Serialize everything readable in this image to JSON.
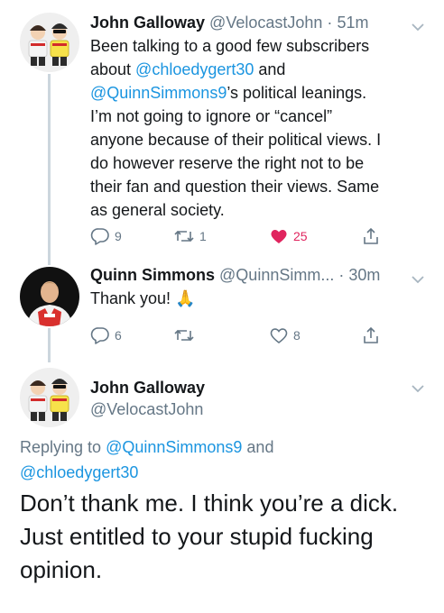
{
  "tweets": [
    {
      "name": "John Galloway",
      "handle": "@VelocastJohn",
      "separator": "·",
      "time": "51m",
      "text_lines": [
        [
          {
            "t": "Been talking to a good few subscribers"
          }
        ],
        [
          {
            "t": "about "
          },
          {
            "t": "@chloedygert30",
            "mention": true
          },
          {
            "t": " and"
          }
        ],
        [
          {
            "t": "@QuinnSimmons9",
            "mention": true
          },
          {
            "t": "’s political leanings."
          }
        ],
        [
          {
            "t": "I’m not going to ignore or “cancel”"
          }
        ],
        [
          {
            "t": "anyone because of their political views. I"
          }
        ],
        [
          {
            "t": "do however reserve the right not to be"
          }
        ],
        [
          {
            "t": "their fan and question their views. Same"
          }
        ],
        [
          {
            "t": "as general society."
          }
        ]
      ],
      "replies": "9",
      "retweets": "1",
      "likes": "25",
      "liked": true
    },
    {
      "name": "Quinn Simmons",
      "handle": "@QuinnSimm...",
      "separator": "·",
      "time": "30m",
      "text": "Thank you! 🙏",
      "replies": "6",
      "retweets": "",
      "likes": "8",
      "liked": false
    }
  ],
  "focused": {
    "name": "John Galloway",
    "handle": "@VelocastJohn",
    "replying_label": "Replying to",
    "replying_to_1": "@QuinnSimmons9",
    "replying_and": " and",
    "replying_to_2": "@chloedygert30",
    "text_lines": [
      "Don’t thank me. I think you’re a dick.",
      "Just entitled to your stupid fucking",
      "opinion."
    ]
  },
  "colors": {
    "link": "#1b95e0",
    "like": "#e0245e",
    "secondary_text": "#657786",
    "thread_line": "#ccd6dd"
  },
  "icons": [
    "reply-icon",
    "retweet-icon",
    "heart-icon",
    "share-icon",
    "chevron-down-icon",
    "praying-hands-emoji"
  ]
}
